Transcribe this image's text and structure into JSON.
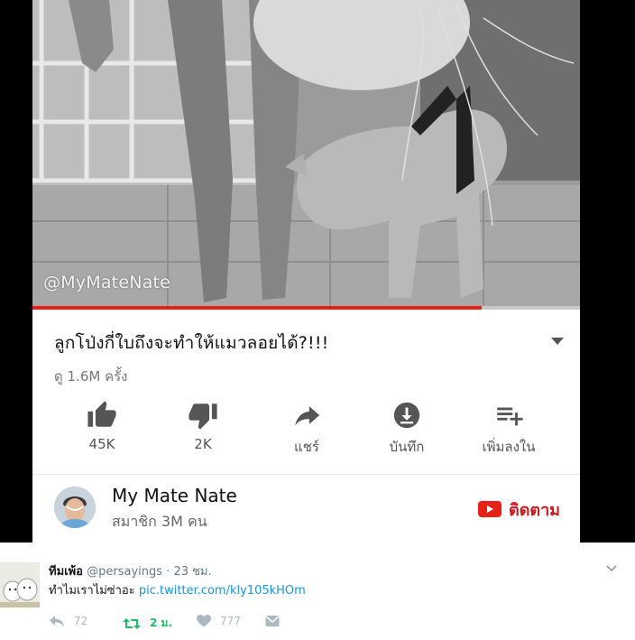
{
  "video": {
    "watermark": "@MyMateNate",
    "progress": 0.82
  },
  "youtube": {
    "title": "ลูกโป่งกี่ใบถึงจะทำให้แมวลอยได้?!!!",
    "views": "ดู 1.6M ครั้ง",
    "actions": [
      {
        "label": "45K",
        "icon": "thumbs-up-icon"
      },
      {
        "label": "2K",
        "icon": "thumbs-down-icon"
      },
      {
        "label": "แชร์",
        "icon": "share-icon"
      },
      {
        "label": "บันทึก",
        "icon": "download-icon"
      },
      {
        "label": "เพิ่มลงใน",
        "icon": "add-to-playlist-icon"
      }
    ],
    "channel": {
      "name": "My Mate Nate",
      "subscribers": "สมาชิก 3M คน",
      "subscribe_label": "ติดตาม"
    },
    "colors": {
      "accent": "#e62117",
      "subscribe": "#cc181e"
    }
  },
  "tweet": {
    "display_name": "ทีมเพ้อ",
    "handle": "@persayings",
    "separator": "·",
    "time": "23 ชม.",
    "text": "ทำไมเราไม่ซ่าอะ ",
    "link": "pic.twitter.com/kly105kHOm",
    "reply_count": "72",
    "retweet_count": "2 ม.",
    "like_count": "777",
    "colors": {
      "link": "#1b95e0",
      "retweet": "#17bf63",
      "muted": "#aab8c2"
    }
  }
}
